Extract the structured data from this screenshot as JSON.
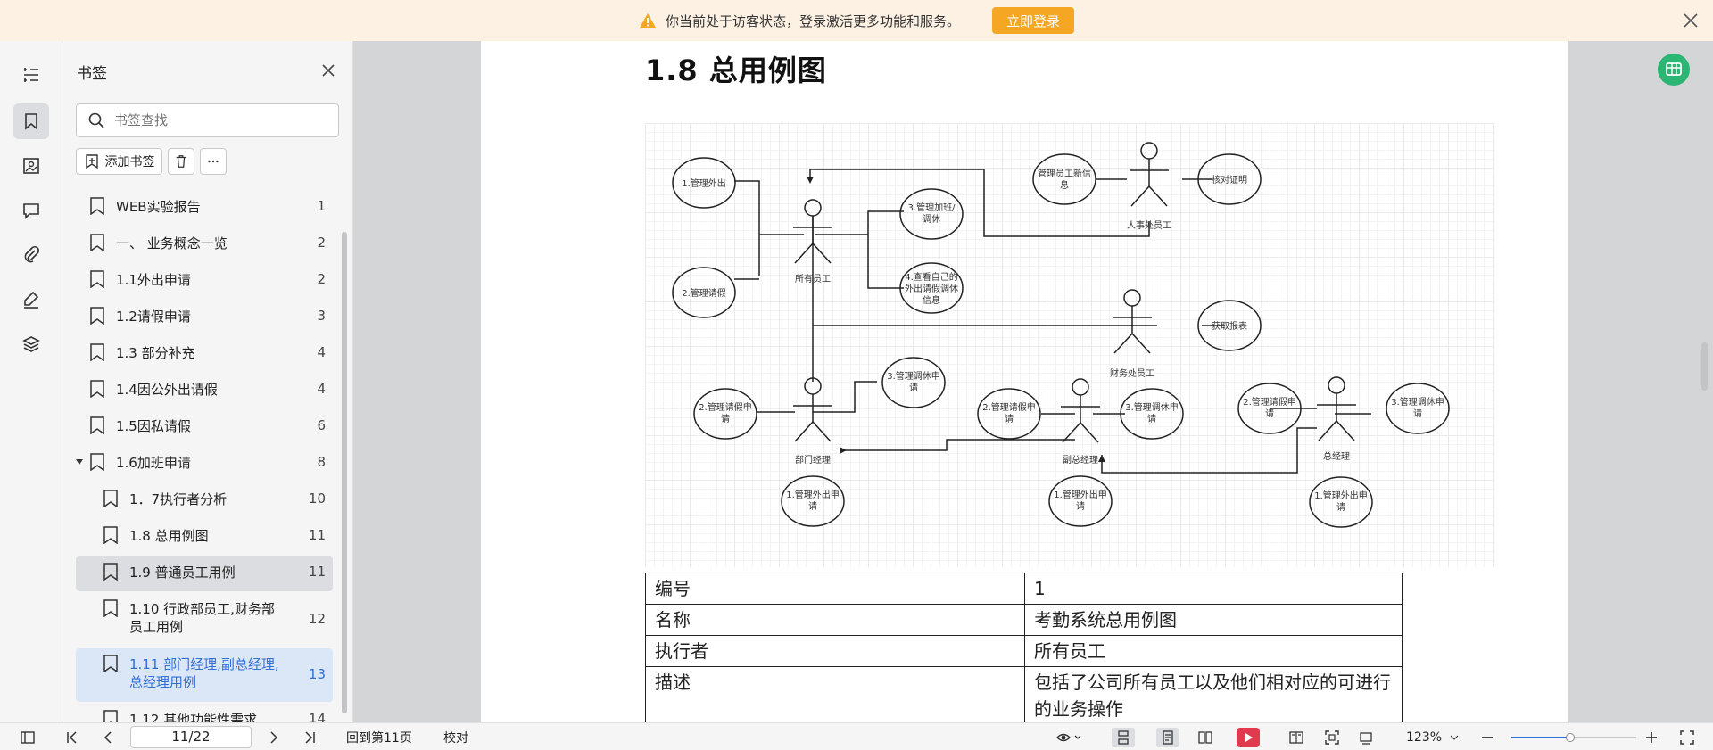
{
  "notice": {
    "message": "你当前处于访客状态，登录激活更多功能和服务。",
    "login_label": "立即登录",
    "accent": "#f5a623"
  },
  "rail": {
    "icons": [
      "outline-icon",
      "bookmark-icon",
      "image-icon",
      "comment-icon",
      "attachment-icon",
      "signature-icon",
      "layers-icon"
    ],
    "active": "bookmark-icon"
  },
  "bookmarks": {
    "title": "书签",
    "search_placeholder": "书签查找",
    "add_label": "添加书签",
    "items": [
      {
        "label": "WEB实验报告",
        "page": "1",
        "level": 0
      },
      {
        "label": "一、 业务概念一览",
        "page": "2",
        "level": 0
      },
      {
        "label": "1.1外出申请",
        "page": "2",
        "level": 0
      },
      {
        "label": "1.2请假申请",
        "page": "3",
        "level": 0
      },
      {
        "label": "1.3 部分补充",
        "page": "4",
        "level": 0
      },
      {
        "label": "1.4因公外出请假",
        "page": "4",
        "level": 0
      },
      {
        "label": "1.5因私请假",
        "page": "6",
        "level": 0
      },
      {
        "label": "1.6加班申请",
        "page": "8",
        "level": 0
      },
      {
        "label": "1．7执行者分析",
        "page": "10",
        "level": 1
      },
      {
        "label": "1.8 总用例图",
        "page": "11",
        "level": 1
      },
      {
        "label": "1.9 普通员工用例",
        "page": "11",
        "level": 1
      },
      {
        "label": "1.10 行政部员工,财务部员工用例",
        "page": "12",
        "level": 1
      },
      {
        "label": "1.11 部门经理,副总经理,总经理用例",
        "page": "13",
        "level": 1
      },
      {
        "label": "1.12 其他功能性需求",
        "page": "14",
        "level": 1
      }
    ]
  },
  "document": {
    "heading": "1.8  总用例图",
    "diagram": {
      "actors": [
        "所有员工",
        "人事处员工",
        "财务处员工",
        "部门经理",
        "副总经理",
        "总经理"
      ],
      "usecases": {
        "uc1": "1.管理外出",
        "uc2": "2.管理请假",
        "uc3a": "3.管理加班/",
        "uc3b": "调休",
        "uc4a": "4.查看自己的",
        "uc4b": "外出请假调休",
        "uc4c": "信息",
        "hr1a": "管理员工新信",
        "hr1b": "息",
        "hr2": "核对证明",
        "fin1": "获取报表",
        "req": "请",
        "leave_req": "2.管理请假申",
        "shift_req": "3.管理调休申",
        "out_req": "1.管理外出申"
      }
    },
    "table": [
      {
        "key": "编号",
        "value": "1"
      },
      {
        "key": "名称",
        "value": "考勤系统总用例图"
      },
      {
        "key": "执行者",
        "value": "所有员工"
      },
      {
        "key": "描述",
        "value": "包括了公司所有员工以及他们相对应的可进行的业务操作"
      }
    ]
  },
  "bottombar": {
    "page_value": "11/22",
    "goto_label": "回到第11页",
    "proof_label": "校对",
    "zoom": "123%",
    "zoom_fraction": 0.47
  }
}
